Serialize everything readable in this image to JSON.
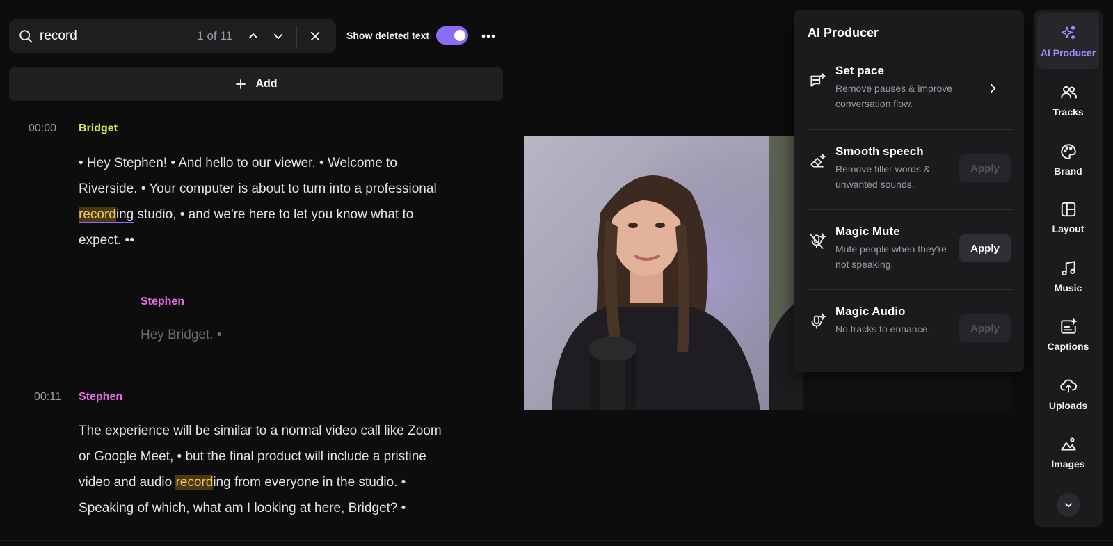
{
  "search": {
    "query": "record",
    "count": "1 of 11"
  },
  "toggle": {
    "label": "Show deleted text",
    "on": true
  },
  "add_label": "Add",
  "transcript": [
    {
      "time": "00:00",
      "speaker": "Bridget",
      "speaker_color": "#c7ee4e",
      "text_parts": [
        "• Hey Stephen! • And hello to our viewer. • Welcome to Riverside. • Your computer is about to turn into a professional ",
        "record",
        "ing studio, • and we're here to let you know what to expect. ••"
      ]
    },
    {
      "time": "",
      "speaker": "Stephen",
      "speaker_color": "#e96be5",
      "deleted_text": "Hey Bridget. •"
    },
    {
      "time": "00:11",
      "speaker": "Stephen",
      "speaker_color": "#e96be5",
      "text_parts": [
        "The experience will be similar to a normal video call like Zoom or Google Meet, • but the final product will include a pristine video and audio ",
        "record",
        "ing from everyone in the studio. • Speaking of which, what am I looking at here, Bridget? •"
      ]
    }
  ],
  "ai_producer": {
    "title": "AI Producer",
    "items": [
      {
        "name": "Set pace",
        "desc": "Remove pauses & improve conversation flow.",
        "icon": "chat-sparkle-icon",
        "action": "chevron"
      },
      {
        "name": "Smooth speech",
        "desc": "Remove filler words & unwanted sounds.",
        "icon": "eraser-sparkle-icon",
        "action": "Apply",
        "enabled": false
      },
      {
        "name": "Magic Mute",
        "desc": "Mute people when they're not speaking.",
        "icon": "mic-off-sparkle-icon",
        "action": "Apply",
        "enabled": true
      },
      {
        "name": "Magic Audio",
        "desc": "No tracks to enhance.",
        "icon": "mic-sparkle-icon",
        "action": "Apply",
        "enabled": false
      }
    ]
  },
  "sidebar": {
    "items": [
      {
        "label": "AI Producer",
        "icon": "sparkles-icon",
        "active": true
      },
      {
        "label": "Tracks",
        "icon": "users-icon"
      },
      {
        "label": "Brand",
        "icon": "palette-icon"
      },
      {
        "label": "Layout",
        "icon": "layout-icon"
      },
      {
        "label": "Music",
        "icon": "music-note-icon"
      },
      {
        "label": "Captions",
        "icon": "captions-icon"
      },
      {
        "label": "Uploads",
        "icon": "cloud-upload-icon"
      },
      {
        "label": "Images",
        "icon": "image-icon"
      }
    ]
  },
  "colors": {
    "accent": "#8b6cf6",
    "highlight": "#f1c65a",
    "bridget": "#c7ee4e",
    "stephen": "#e96be5"
  }
}
